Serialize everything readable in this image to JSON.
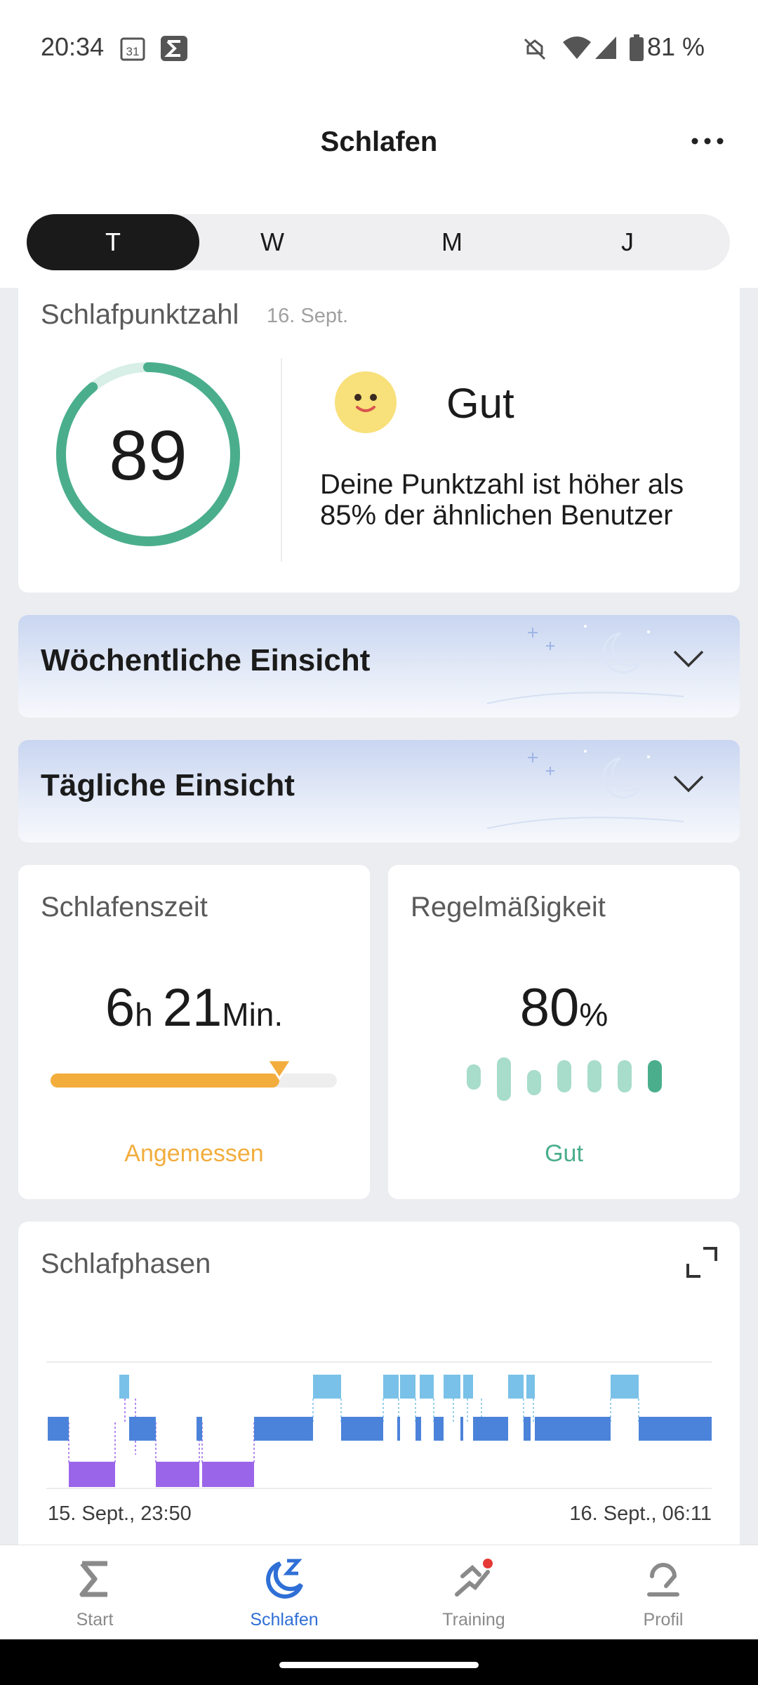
{
  "status_bar": {
    "time": "20:34",
    "calendar_day": "31",
    "battery": "81 %",
    "icons": [
      "calendar-icon",
      "sigma-app-icon",
      "mute-icon",
      "wifi-icon",
      "signal-icon",
      "battery-icon"
    ]
  },
  "header": {
    "title": "Schlafen",
    "tabs": [
      {
        "label": "T",
        "active": true
      },
      {
        "label": "W",
        "active": false
      },
      {
        "label": "M",
        "active": false
      },
      {
        "label": "J",
        "active": false
      }
    ]
  },
  "score_card": {
    "title": "Schlafpunktzahl",
    "date": "16. Sept.",
    "score": "89",
    "score_fraction": 0.89,
    "rating": "Gut",
    "description_line1": "Deine Punktzahl ist höher als",
    "description_line2": "85% der ähnlichen Benutzer"
  },
  "weekly_insight": {
    "label": "Wöchentliche Einsicht"
  },
  "daily_insight": {
    "label": "Tägliche Einsicht"
  },
  "sleep_time": {
    "title": "Schlafenszeit",
    "hours": "6",
    "hours_unit": "h",
    "minutes": "21",
    "minutes_unit": "Min.",
    "progress_fraction": 0.8,
    "status": "Angemessen"
  },
  "regularity": {
    "title": "Regelmäßigkeit",
    "value": "80",
    "unit": "%",
    "status": "Gut"
  },
  "sleep_phases": {
    "title": "Schlafphasen",
    "start_label": "15. Sept., 23:50",
    "end_label": "16. Sept., 06:11"
  },
  "bottom_nav": [
    {
      "label": "Start",
      "icon": "sigma-icon",
      "active": false
    },
    {
      "label": "Schlafen",
      "icon": "moon-sleep-icon",
      "active": true
    },
    {
      "label": "Training",
      "icon": "running-icon",
      "active": false
    },
    {
      "label": "Profil",
      "icon": "profile-icon",
      "active": false
    }
  ],
  "colors": {
    "accent_blue": "#2f6fd6",
    "score_green": "#4aae8c",
    "sleep_orange": "#f2ad3d",
    "awake": "#79c1e8",
    "light_sleep": "#4c83da",
    "deep_sleep": "#9b65ea"
  }
}
